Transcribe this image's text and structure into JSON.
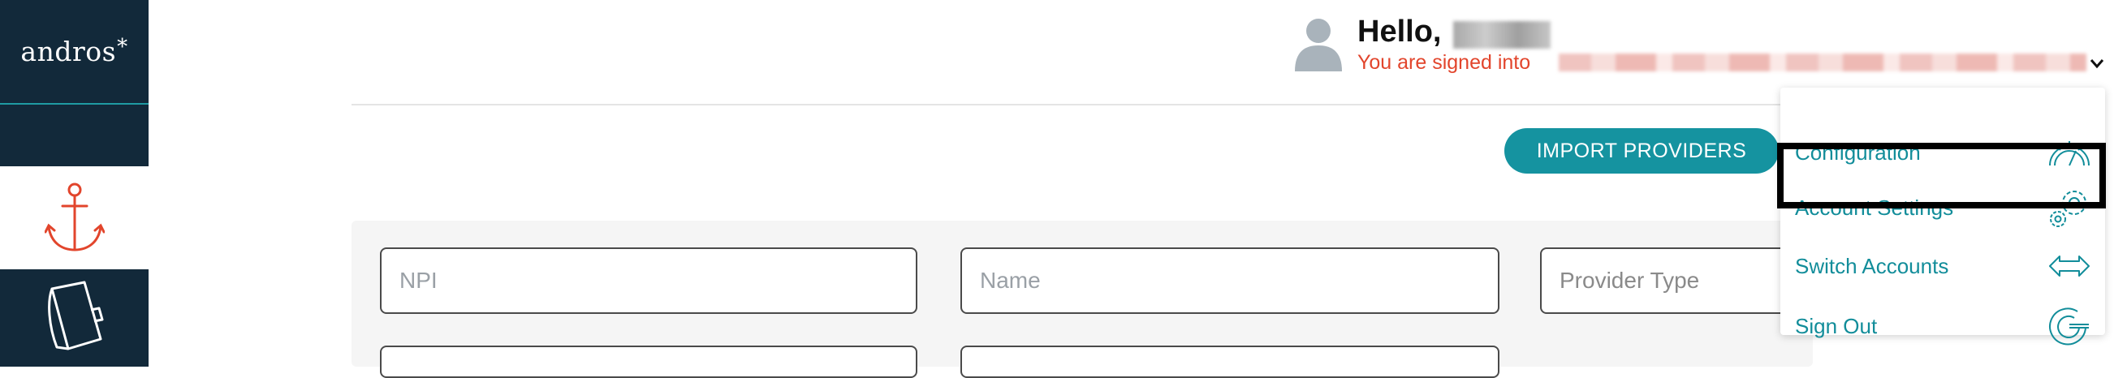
{
  "sidebar": {
    "logo_text": "andros",
    "logo_mark": "*",
    "items": [
      {
        "icon": "anchor-icon",
        "active": true,
        "color": "#e2452c"
      },
      {
        "icon": "notebook-icon",
        "active": false,
        "color": "#ffffff"
      }
    ]
  },
  "header": {
    "greeting": "Hello,",
    "signed_in_text": "You are signed into"
  },
  "actions": {
    "import_label": "IMPORT PROVIDERS"
  },
  "form": {
    "npi_placeholder": "NPI",
    "name_placeholder": "Name",
    "provider_type_placeholder": "Provider Type"
  },
  "menu": {
    "items": [
      {
        "label": "Configuration",
        "icon": "speedometer-icon"
      },
      {
        "label": "Account Settings",
        "icon": "gears-icon",
        "highlighted": true
      },
      {
        "label": "Switch Accounts",
        "icon": "switch-arrows-icon"
      },
      {
        "label": "Sign Out",
        "icon": "sign-out-icon"
      }
    ]
  },
  "colors": {
    "sidebar_bg": "#12293a",
    "accent_teal": "#1593a0",
    "accent_red": "#e2452c"
  }
}
